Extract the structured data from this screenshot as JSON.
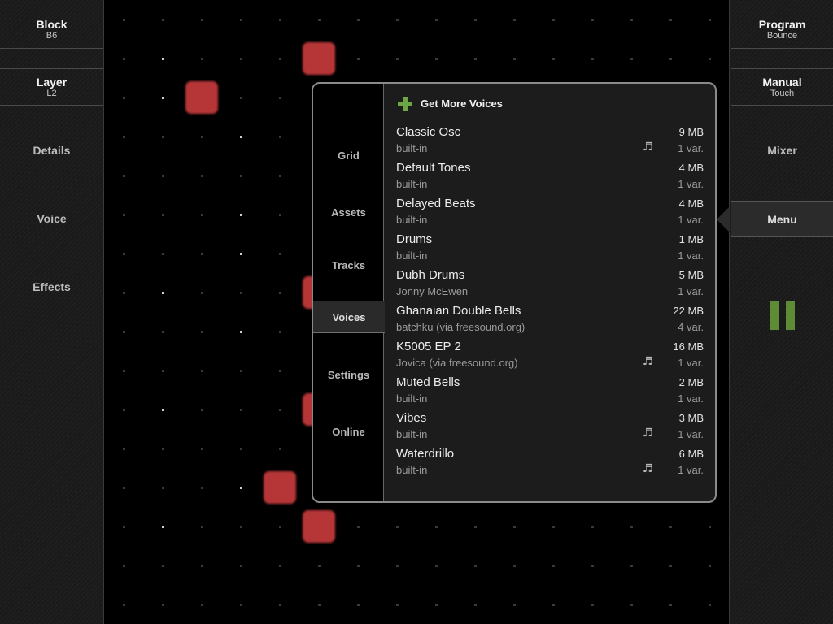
{
  "left_panel": {
    "block": {
      "label": "Block",
      "value": "B6"
    },
    "layer": {
      "label": "Layer",
      "value": "L2"
    },
    "details": "Details",
    "voice": "Voice",
    "effects": "Effects"
  },
  "right_panel": {
    "program": {
      "label": "Program",
      "value": "Bounce"
    },
    "manual": {
      "label": "Manual",
      "value": "Touch"
    },
    "mixer": "Mixer",
    "menu": "Menu",
    "pause_icon": "pause-icon",
    "pause_color": "#5d8b36"
  },
  "colors": {
    "note_block": "#c0393b",
    "accent_green": "#6ea544"
  },
  "menu_popup": {
    "tabs": [
      "Grid",
      "Assets",
      "Tracks",
      "Voices",
      "Settings",
      "Online"
    ],
    "active_tab": "Voices",
    "get_more": "Get More Voices",
    "voices": [
      {
        "name": "Classic Osc",
        "author": "built-in",
        "size": "9 MB",
        "vars": "1 var.",
        "icon": "music-note-icon"
      },
      {
        "name": "Default Tones",
        "author": "built-in",
        "size": "4 MB",
        "vars": "1 var.",
        "icon": ""
      },
      {
        "name": "Delayed Beats",
        "author": "built-in",
        "size": "4 MB",
        "vars": "1 var.",
        "icon": ""
      },
      {
        "name": "Drums",
        "author": "built-in",
        "size": "1 MB",
        "vars": "1 var.",
        "icon": ""
      },
      {
        "name": "Dubh Drums",
        "author": "Jonny McEwen",
        "size": "5 MB",
        "vars": "1 var.",
        "icon": ""
      },
      {
        "name": "Ghanaian Double Bells",
        "author": "batchku (via freesound.org)",
        "size": "22 MB",
        "vars": "4 var.",
        "icon": ""
      },
      {
        "name": "K5005 EP 2",
        "author": "Jovica (via freesound.org)",
        "size": "16 MB",
        "vars": "1 var.",
        "icon": "music-note-icon"
      },
      {
        "name": "Muted Bells",
        "author": "built-in",
        "size": "2 MB",
        "vars": "1 var.",
        "icon": ""
      },
      {
        "name": "Vibes",
        "author": "built-in",
        "size": "3 MB",
        "vars": "1 var.",
        "icon": "music-note-icon"
      },
      {
        "name": "Waterdrillo",
        "author": "built-in",
        "size": "6 MB",
        "vars": "1 var.",
        "icon": "music-note-icon"
      }
    ]
  }
}
